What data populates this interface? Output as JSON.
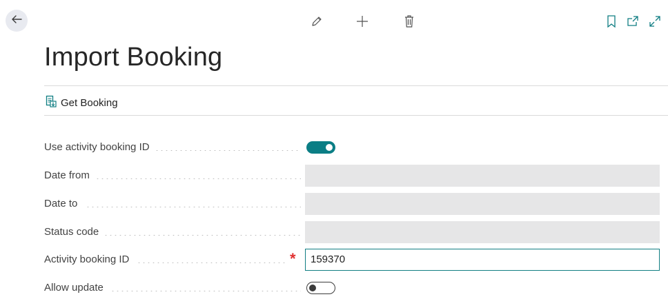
{
  "page": {
    "title": "Import Booking"
  },
  "toolbar": {
    "icons": [
      "back-arrow-icon",
      "pencil-icon",
      "plus-icon",
      "trash-icon",
      "bookmark-icon",
      "open-new-window-icon",
      "expand-icon"
    ]
  },
  "actions": {
    "get_booking_label": "Get Booking"
  },
  "fields": [
    {
      "label": "Use activity booking ID",
      "type": "toggle",
      "value": true
    },
    {
      "label": "Date from",
      "type": "date",
      "value": "",
      "disabled": true
    },
    {
      "label": "Date to",
      "type": "date",
      "value": "",
      "disabled": true
    },
    {
      "label": "Status code",
      "type": "text",
      "value": "",
      "disabled": true
    },
    {
      "label": "Activity booking ID",
      "type": "text",
      "value": "159370",
      "required": true
    },
    {
      "label": "Allow update",
      "type": "toggle",
      "value": false
    }
  ],
  "colors": {
    "accent": "#0b7e85",
    "required": "#e02f2f",
    "disabled_field": "#e6e6e7"
  }
}
